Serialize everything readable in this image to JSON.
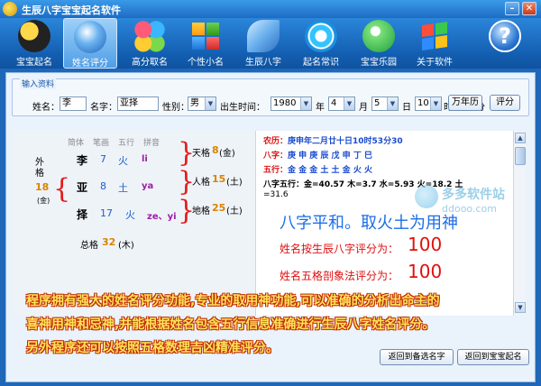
{
  "window": {
    "title": "生辰八字宝宝起名软件",
    "min_glyph": "–",
    "close_glyph": "✕"
  },
  "toolbar": [
    {
      "label": "宝宝起名",
      "icon": "yinyang-icon"
    },
    {
      "label": "姓名评分",
      "icon": "globe-icon",
      "active": true
    },
    {
      "label": "高分取名",
      "icon": "blocks-icon"
    },
    {
      "label": "个性小名",
      "icon": "squares-icon"
    },
    {
      "label": "生辰八字",
      "icon": "leaf-icon"
    },
    {
      "label": "起名常识",
      "icon": "swirl-icon"
    },
    {
      "label": "宝宝乐园",
      "icon": "bubble-icon"
    },
    {
      "label": "关于软件",
      "icon": "flag-icon"
    },
    {
      "label": "",
      "icon": "help-icon",
      "glyph": "?"
    }
  ],
  "form": {
    "legend": "输入资料",
    "surname_label": "姓名：",
    "surname": "李",
    "given_label": "名字：",
    "given": "亚择",
    "gender_label": "性别：",
    "gender": "男",
    "birth_label": "出生时间：",
    "year": "1980",
    "year_unit": "年",
    "month": "4",
    "month_unit": "月",
    "day": "5",
    "day_unit": "日",
    "hour": "10",
    "hour_unit": "时",
    "minute": "40",
    "minute_unit": "分",
    "calendar_button": "万年历",
    "score_button": "评分"
  },
  "analysis": {
    "headers": [
      "简体",
      "笔画",
      "五行",
      "拼音"
    ],
    "chars": [
      {
        "char": "李",
        "strokes": "7",
        "element": "火",
        "pinyin": "li"
      },
      {
        "char": "亚",
        "strokes": "8",
        "element": "土",
        "pinyin": "ya"
      },
      {
        "char": "择",
        "strokes": "17",
        "element": "火",
        "pinyin": "ze、yi"
      }
    ],
    "waige": {
      "label": "外格",
      "value": "18",
      "element": "(金)"
    },
    "tiange": {
      "label": "天格",
      "value": "8",
      "element": "(金)"
    },
    "renge": {
      "label": "人格",
      "value": "15",
      "element": "(土)"
    },
    "dige": {
      "label": "地格",
      "value": "25",
      "element": "(土)"
    },
    "zongge": {
      "label": "总格",
      "value": "32",
      "element": "(木)"
    }
  },
  "result": {
    "lunar_label": "农历：",
    "lunar": "庚申年二月廿十日10时53分30",
    "bazi_label": "八字：",
    "bazi": "庚 申 庚 辰 戊 申 丁 巳",
    "wuxing_label": "五行：",
    "wuxing": "金 金 金 土 土 金 火 火",
    "strength_label": "八字五行：",
    "strength": "金=40.57 木=3.7 水=5.93 火=18.2 土",
    "strength_cont": "=31.6",
    "summary": "八字平和。取火土为用神",
    "bazi_score_label": "姓名按生辰八字评分为：",
    "bazi_score": "100",
    "wuge_score_label": "姓名五格剖象法评分为：",
    "wuge_score": "100"
  },
  "watermark": {
    "name": "多多软件站",
    "url": "ddooo.com"
  },
  "overlay_lines": [
    "程序拥有强大的姓名评分功能,专业的取用神功能,可以准确的分析出命主的",
    "喜神用神和忌神,并能根据姓名包含五行信息准确进行生辰八字姓名评分。",
    "另外程序还可以按照五格数理吉凶精准评分。"
  ],
  "footer": {
    "back_select": "返回到备选名字",
    "back_baby": "返回到宝宝起名"
  },
  "colors": {
    "toolbar": "#1d6cc4",
    "accent_red": "#e01010",
    "accent_blue": "#1a4cd0",
    "overlay_text": "#ffe35a"
  }
}
